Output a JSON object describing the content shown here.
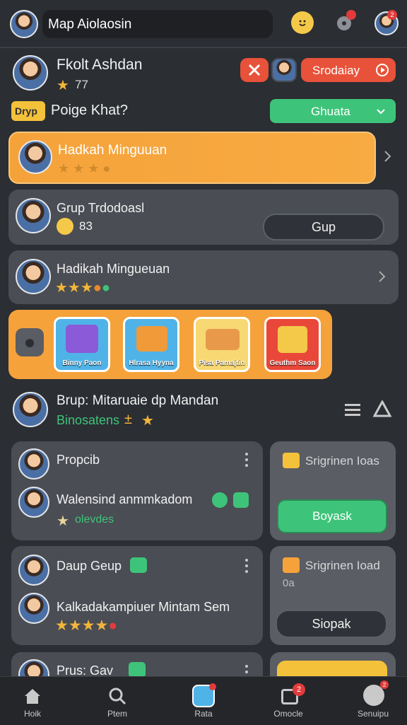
{
  "header": {
    "search_title": "Map Aiolaosin",
    "badge_count": "2"
  },
  "profile": {
    "name": "Fkolt Ashdan",
    "score": "77",
    "rank_badge": "Dryp",
    "rank_text": "Poige Khat?",
    "action_button": "Srodaiay",
    "dropdown_value": "Ghuata"
  },
  "entries": [
    {
      "name": "Hadkah Minguuan",
      "extra": ""
    },
    {
      "name": "Grup Trdodoasl",
      "score": "83",
      "button": "Gup"
    },
    {
      "name": "Hadikah Mingueuan"
    }
  ],
  "tiles": [
    {
      "label": "Binny Paon",
      "color": "#4fb3e8"
    },
    {
      "label": "Hlrasa Hyyna",
      "color": "#4fb3e8"
    },
    {
      "label": "Pisa Pamajtin",
      "color": "#f7d873"
    },
    {
      "label": "Geuthm Saon",
      "color": "#e8473a"
    }
  ],
  "group": {
    "title": "Brup: Mitaruaie dp Mandan",
    "subtitle": "Binosatens",
    "subtitle_mark": "±"
  },
  "feed": [
    {
      "title": "Propcib",
      "body": "Walensind anmmkadom",
      "tag": "olevdes"
    },
    {
      "title": "Daup Geup",
      "body": "Kalkadakampiuer Mintam Sem"
    },
    {
      "title": "Prus: Gav"
    }
  ],
  "side_cards": [
    {
      "title": "Srigrinen Ioas",
      "button": "Boyask"
    },
    {
      "title": "Srigrinen Ioad",
      "sub": "0a",
      "button": "Siopak"
    }
  ],
  "nav": [
    {
      "label": "Hoik"
    },
    {
      "label": "Ptem"
    },
    {
      "label": "Rata"
    },
    {
      "label": "Omocle"
    },
    {
      "label": "Senuipu"
    }
  ],
  "nav_badges": [
    "2",
    "2"
  ],
  "colors": {
    "background": "#2b2e33",
    "accent_orange": "#f5a23a",
    "accent_green": "#3ec47a",
    "accent_red": "#e8523a",
    "card": "#4a4d54"
  }
}
